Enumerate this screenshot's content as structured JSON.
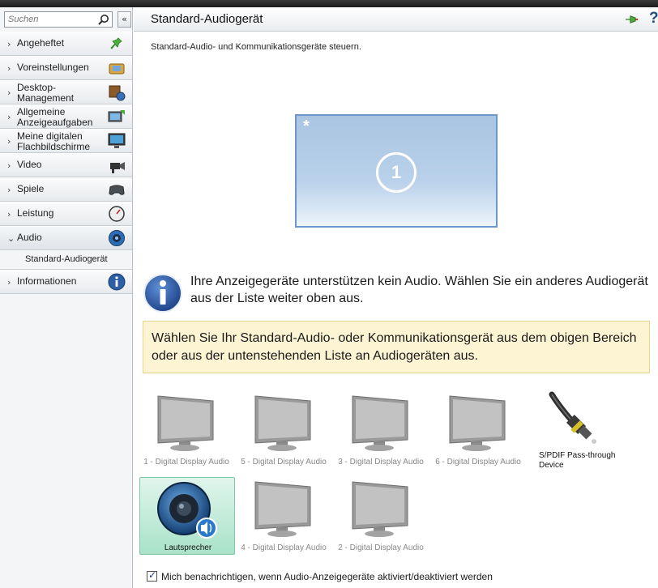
{
  "sidebar": {
    "search_placeholder": "Suchen",
    "collapse_glyph": "«",
    "items": [
      {
        "label": "Angeheftet",
        "icon": "pin-icon"
      },
      {
        "label": "Voreinstellungen",
        "icon": "preset-icon"
      },
      {
        "label": "Desktop-\nManagement",
        "icon": "desktop-management-icon"
      },
      {
        "label": "Allgemeine\nAnzeigeaufgaben",
        "icon": "display-tasks-icon"
      },
      {
        "label": "Meine digitalen\nFlachbildschirme",
        "icon": "flat-panel-icon"
      },
      {
        "label": "Video",
        "icon": "video-camera-icon"
      },
      {
        "label": "Spiele",
        "icon": "gamepad-icon"
      },
      {
        "label": "Leistung",
        "icon": "gauge-icon"
      },
      {
        "label": "Audio",
        "icon": "speaker-icon"
      },
      {
        "label": "Informationen",
        "icon": "info-icon"
      }
    ],
    "subitem": "Standard-Audiogerät"
  },
  "header": {
    "title": "Standard-Audiogerät",
    "help_glyph": "?"
  },
  "main": {
    "subtitle": "Standard-Audio- und Kommunikationsgeräte steuern.",
    "monitor": {
      "star": "*",
      "number": "1"
    },
    "info_text": "Ihre Anzeigegeräte unterstützen kein Audio. Wählen Sie ein anderes Audiogerät aus der Liste weiter oben aus.",
    "warn_text": "Wählen Sie Ihr Standard-Audio- oder Kommunikationsgerät aus dem obigen Bereich oder aus der untenstehenden Liste an Audiogeräten aus.",
    "devices": [
      {
        "label": "1 - Digital Display Audio"
      },
      {
        "label": "5 - Digital Display Audio"
      },
      {
        "label": "3 - Digital Display Audio"
      },
      {
        "label": "6 - Digital Display Audio"
      },
      {
        "label": "S/PDIF Pass-through Device"
      },
      {
        "label": "Lautsprecher"
      },
      {
        "label": "4 - Digital Display Audio"
      },
      {
        "label": "2 - Digital Display Audio"
      }
    ],
    "notify_label": "Mich benachrichtigen, wenn Audio-Anzeigegeräte aktiviert/deaktiviert werden",
    "notify_checked": true
  },
  "colors": {
    "selected_bg": "#a9e2c9",
    "warn_bg": "#fdf4d3",
    "monitor_border": "#6d97c9",
    "info_blue": "#1e4d9a"
  }
}
